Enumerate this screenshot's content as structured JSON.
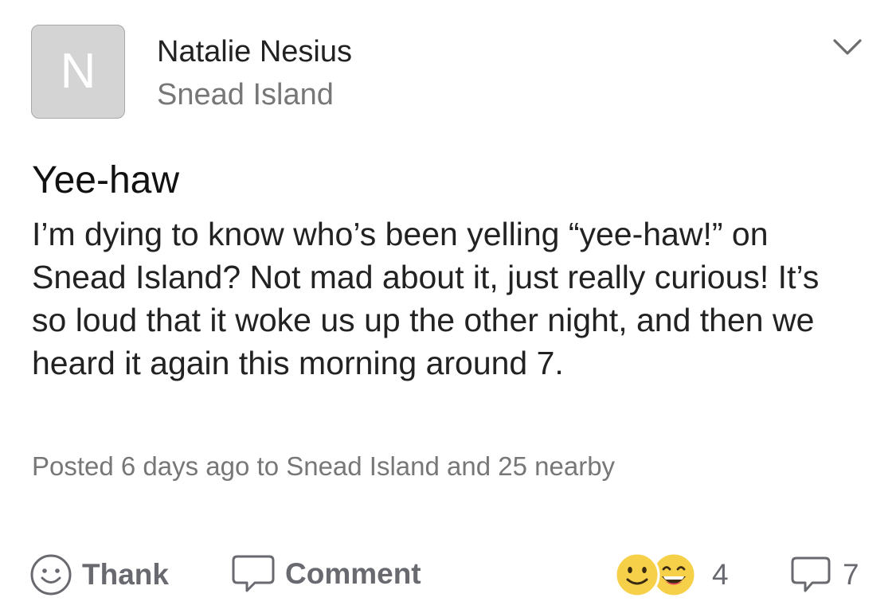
{
  "author": {
    "initial": "N",
    "name": "Natalie Nesius",
    "location": "Snead Island"
  },
  "post": {
    "title": "Yee-haw",
    "body": "I’m dying to know who’s been yelling “yee-haw!” on Snead Island? Not mad about it, just really curious! It’s so loud that it woke us up the other night, and then we heard it again this morning around 7.",
    "meta": "Posted 6 days ago to Snead Island and 25 nearby"
  },
  "actions": {
    "thank_label": "Thank",
    "comment_label": "Comment"
  },
  "stats": {
    "reaction_count": "4",
    "comment_count": "7"
  },
  "icons": {
    "menu": "chevron-down-icon",
    "thank": "smile-outline-icon",
    "comment": "speech-bubble-icon",
    "reactions": [
      "smiley-emoji-icon",
      "grinning-emoji-icon"
    ]
  },
  "colors": {
    "text_primary": "#222222",
    "text_secondary": "#777777",
    "action_gray": "#686a70",
    "avatar_bg": "#d4d4d4",
    "emoji_yellow": "#f7d04a"
  }
}
